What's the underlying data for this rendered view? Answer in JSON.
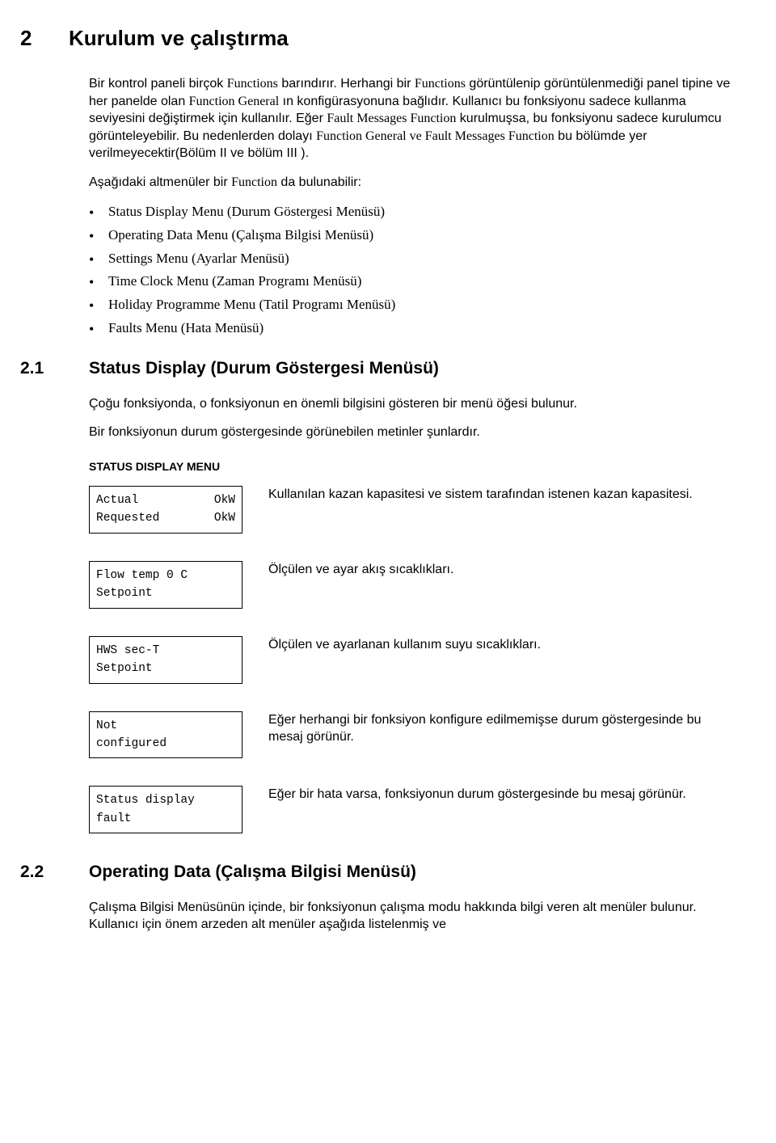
{
  "section2": {
    "number": "2",
    "title": "Kurulum ve çalıştırma",
    "para1_a": "Bir kontrol paneli birçok ",
    "para1_b": "Functions",
    "para1_c": " barındırır. Herhangi bir ",
    "para1_d": "Functions",
    "para1_e": " görüntülenip görüntülenmediği panel tipine ve  her panelde olan ",
    "para1_f": "Function General",
    "para1_g": " ın konfigürasyonuna bağlıdır. Kullanıcı bu fonksiyonu sadece kullanma seviyesini değiştirmek için kullanılır. Eğer ",
    "para1_h": "Fault Messages Function",
    "para1_i": " kurulmuşsa,  bu fonksiyonu sadece kurulumcu görünteleyebilir. Bu nedenlerden dolayı  ",
    "para1_j": "Function General",
    "para1_k": " ve ",
    "para1_l": "Fault Messages Function",
    "para1_m": "  bu bölümde yer verilmeyecektir(Bölüm II ve bölüm III ).",
    "para2_a": "Aşağıdaki altmenüler bir ",
    "para2_b": "Function",
    "para2_c": " da bulunabilir:",
    "bullets": [
      "Status Display Menu (Durum Göstergesi Menüsü)",
      "Operating Data Menu  (Çalışma Bilgisi Menüsü)",
      "Settings Menu (Ayarlar Menüsü)",
      "Time Clock Menu (Zaman Programı Menüsü)",
      "Holiday Programme Menu (Tatil Programı Menüsü)",
      "Faults Menu (Hata Menüsü)"
    ]
  },
  "section21": {
    "number": "2.1",
    "title": "Status Display (Durum Göstergesi Menüsü)",
    "para1": "Çoğu fonksiyonda, o fonksiyonun en önemli bilgisini gösteren bir menü öğesi bulunur.",
    "para2": "Bir fonksiyonun durum göstergesinde görünebilen metinler şunlardır.",
    "menu_label": "STATUS DISPLAY MENU",
    "items": [
      {
        "lines": [
          {
            "left": "Actual",
            "right": "OkW"
          },
          {
            "left": "Requested",
            "right": "OkW"
          }
        ],
        "desc": "Kullanılan kazan kapasitesi ve sistem tarafından istenen kazan kapasitesi."
      },
      {
        "lines": [
          {
            "left": "Flow temp 0 C",
            "right": ""
          },
          {
            "left": "Setpoint",
            "right": ""
          }
        ],
        "desc": "Ölçülen ve ayar akış sıcaklıkları."
      },
      {
        "lines": [
          {
            "left": "HWS sec-T",
            "right": ""
          },
          {
            "left": "Setpoint",
            "right": ""
          }
        ],
        "desc": "Ölçülen ve ayarlanan kullanım suyu sıcaklıkları."
      },
      {
        "lines": [
          {
            "left": "Not",
            "right": ""
          },
          {
            "left": "configured",
            "right": ""
          }
        ],
        "desc": "Eğer herhangi bir fonksiyon konfigure edilmemişse durum göstergesinde bu mesaj görünür."
      },
      {
        "lines": [
          {
            "left": "Status display",
            "right": ""
          },
          {
            "left": "fault",
            "right": ""
          }
        ],
        "desc": "Eğer bir hata varsa, fonksiyonun durum göstergesinde bu mesaj görünür."
      }
    ]
  },
  "section22": {
    "number": "2.2",
    "title": "Operating Data (Çalışma Bilgisi Menüsü)",
    "para1": "Çalışma Bilgisi Menüsünün içinde, bir fonksiyonun çalışma modu hakkında bilgi veren alt menüler bulunur. Kullanıcı için önem arzeden alt menüler aşağıda listelenmiş ve"
  }
}
